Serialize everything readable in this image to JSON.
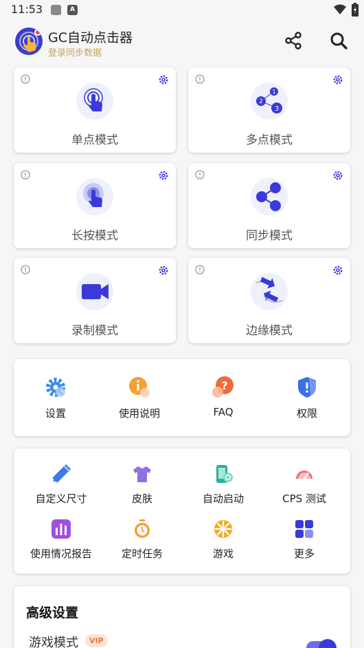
{
  "status": {
    "time": "11:53",
    "notif_badge": "A"
  },
  "header": {
    "title": "GC自动点击器",
    "subtitle": "登录同步数据"
  },
  "modes": [
    {
      "label": "单点模式",
      "icon": "single-tap-icon"
    },
    {
      "label": "多点模式",
      "icon": "multi-tap-icon"
    },
    {
      "label": "长按模式",
      "icon": "long-press-icon"
    },
    {
      "label": "同步模式",
      "icon": "sync-icon"
    },
    {
      "label": "录制模式",
      "icon": "record-icon"
    },
    {
      "label": "边缘模式",
      "icon": "edge-icon"
    }
  ],
  "quick": [
    {
      "label": "设置",
      "icon": "settings-icon"
    },
    {
      "label": "使用说明",
      "icon": "instructions-icon"
    },
    {
      "label": "FAQ",
      "icon": "faq-icon"
    },
    {
      "label": "权限",
      "icon": "permission-icon"
    }
  ],
  "tools": [
    {
      "label": "自定义尺寸",
      "icon": "ruler-icon"
    },
    {
      "label": "皮肤",
      "icon": "skin-icon"
    },
    {
      "label": "自动启动",
      "icon": "autostart-icon"
    },
    {
      "label": "CPS 测试",
      "icon": "speedometer-icon"
    },
    {
      "label": "使用情况报告",
      "icon": "report-icon"
    },
    {
      "label": "定时任务",
      "icon": "timer-icon"
    },
    {
      "label": "游戏",
      "icon": "game-icon"
    },
    {
      "label": "更多",
      "icon": "more-icon"
    }
  ],
  "advanced": {
    "title": "高级设置",
    "game_mode": "游戏模式",
    "vip": "VIP",
    "game_mode_on": true
  },
  "colors": {
    "accent": "#3a3ad8",
    "subtitle": "#c9a45a",
    "vip_bg": "#fbe3d6",
    "vip_text": "#e07a3e"
  }
}
